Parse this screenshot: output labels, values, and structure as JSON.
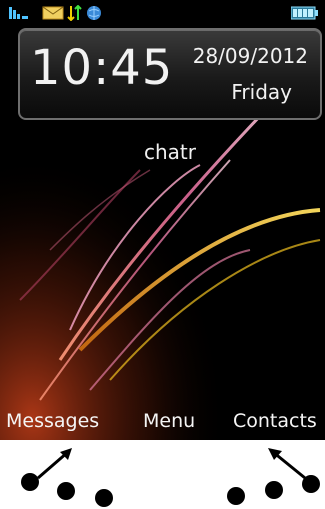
{
  "clock": {
    "time": "10:45",
    "date": "28/09/2012",
    "day": "Friday"
  },
  "carrier": "chatr",
  "softkeys": {
    "left": "Messages",
    "center": "Menu",
    "right": "Contacts"
  },
  "status_icons": [
    "signal-icon",
    "envelope-icon",
    "data-transfer-icon",
    "globe-icon",
    "battery-icon"
  ],
  "colors": {
    "screen_bg": "#000000",
    "accent_pink": "#e06a9a",
    "accent_yellow": "#f0c020",
    "accent_orange": "#c8401a"
  }
}
